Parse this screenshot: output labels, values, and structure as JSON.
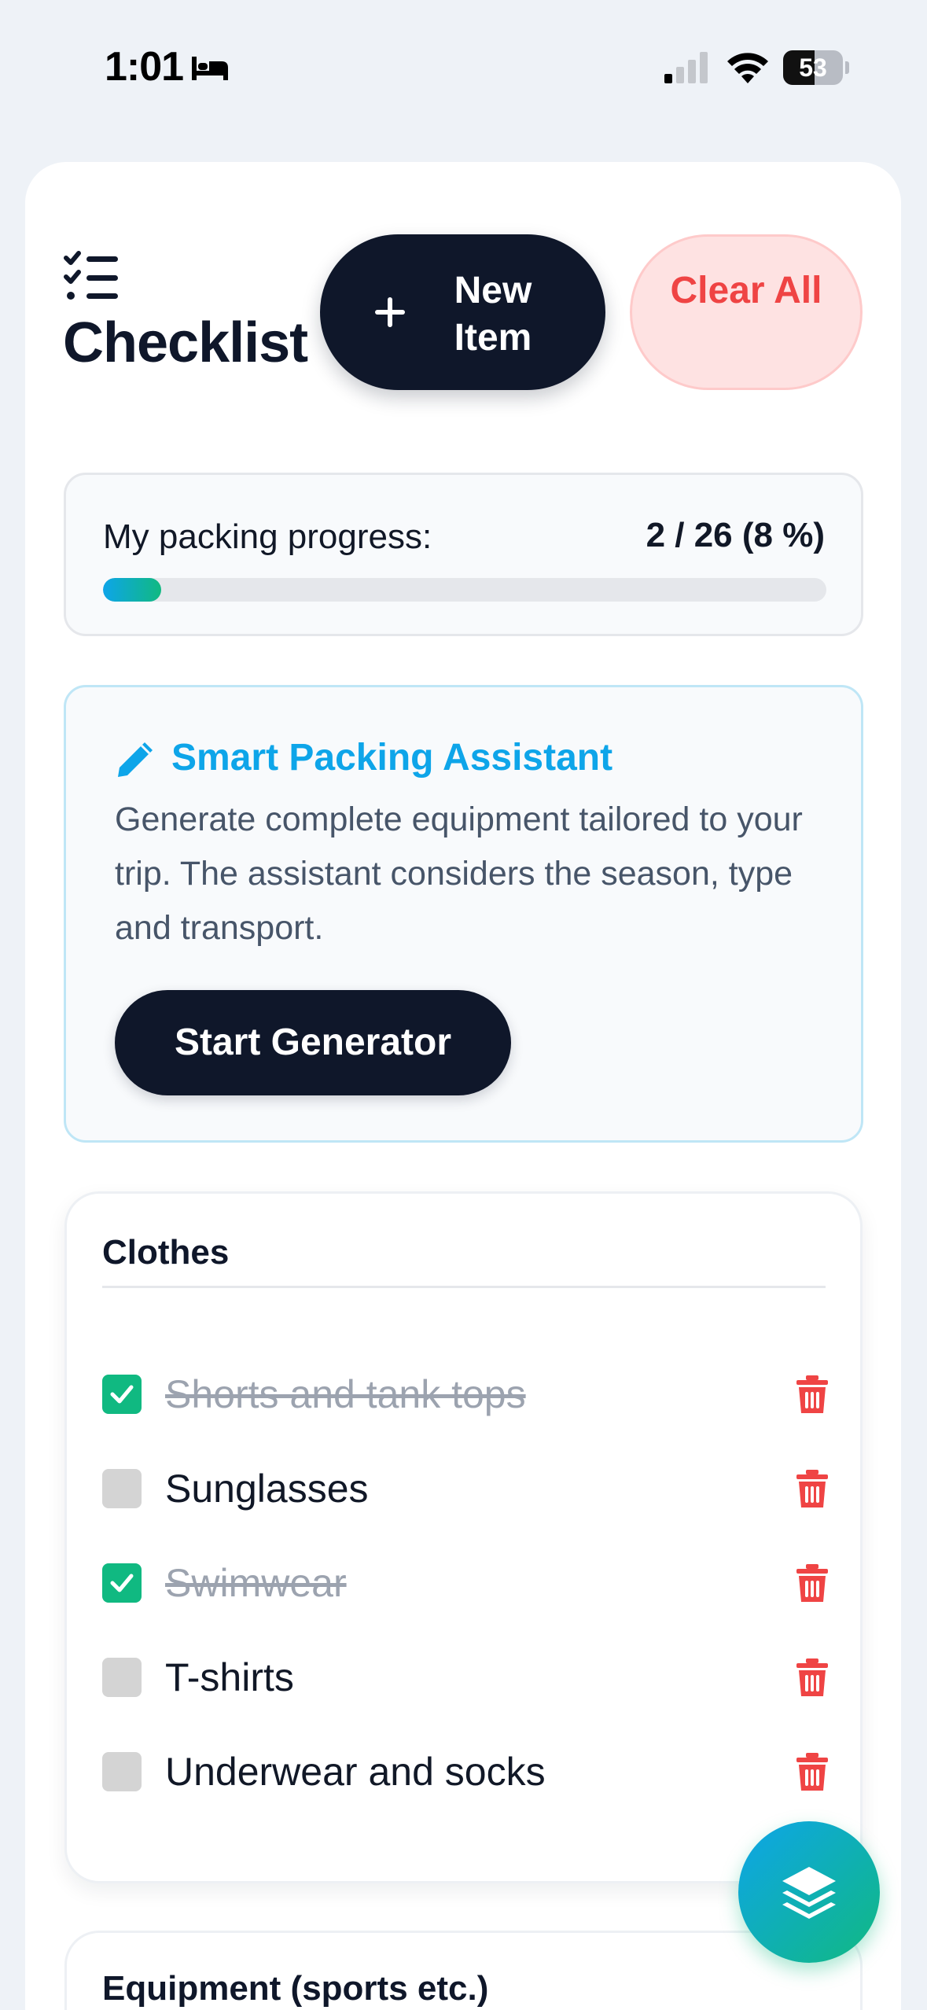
{
  "status_bar": {
    "time": "1:01",
    "battery_level": "53",
    "battery_fraction": 0.53
  },
  "header": {
    "title": "Checklist",
    "new_item_label": "New Item",
    "clear_all_label": "Clear All"
  },
  "progress": {
    "label": "My packing progress:",
    "count_text": "2 / 26 (8 %)",
    "done": 2,
    "total": 26,
    "percent": 8
  },
  "assistant": {
    "title": "Smart Packing Assistant",
    "description": "Generate complete equipment tailored to your trip. The assistant considers the season, type and transport.",
    "button_label": "Start Generator"
  },
  "categories": [
    {
      "title": "Clothes",
      "items": [
        {
          "label": "Shorts and tank tops",
          "checked": true
        },
        {
          "label": "Sunglasses",
          "checked": false
        },
        {
          "label": "Swimwear",
          "checked": true
        },
        {
          "label": "T-shirts",
          "checked": false
        },
        {
          "label": "Underwear and socks",
          "checked": false
        }
      ]
    },
    {
      "title": "Equipment (sports etc.)",
      "items": []
    }
  ],
  "icons": {
    "bed": "bed-icon",
    "signal": "cellular-signal-icon",
    "wifi": "wifi-icon",
    "battery": "battery-icon",
    "checklist": "checklist-icon",
    "plus": "plus-icon",
    "pencil": "pencil-icon",
    "check": "check-icon",
    "trash": "trash-icon",
    "layers": "layers-icon"
  },
  "colors": {
    "primary_dark": "#0f172a",
    "accent_blue": "#0ea5e9",
    "accent_green": "#10b981",
    "danger": "#ef4444",
    "danger_bg": "#fee2e2"
  }
}
